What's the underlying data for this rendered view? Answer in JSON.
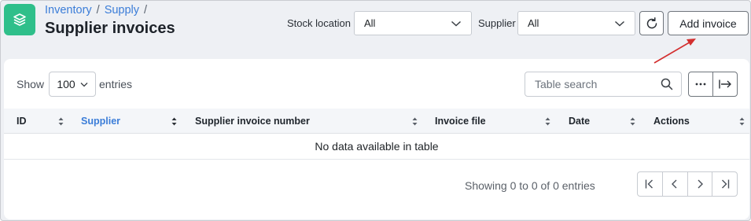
{
  "header": {
    "breadcrumb": [
      "Inventory",
      "Supply"
    ],
    "title": "Supplier invoices",
    "stock_location_label": "Stock location",
    "stock_location_value": "All",
    "supplier_label": "Supplier",
    "supplier_value": "All",
    "add_invoice_label": "Add invoice"
  },
  "table_controls": {
    "show_label": "Show",
    "page_length": "100",
    "entries_label": "entries",
    "search_placeholder": "Table search"
  },
  "table": {
    "columns": [
      "ID",
      "Supplier",
      "Supplier invoice number",
      "Invoice file",
      "Date",
      "Actions"
    ],
    "active_sort_column": "Supplier",
    "empty_message": "No data available in table"
  },
  "footer": {
    "info": "Showing 0 to 0 of 0 entries"
  },
  "colors": {
    "accent": "#3b7dd8",
    "logo": "#2fbf8a",
    "annotation_arrow": "#d32f2f"
  }
}
